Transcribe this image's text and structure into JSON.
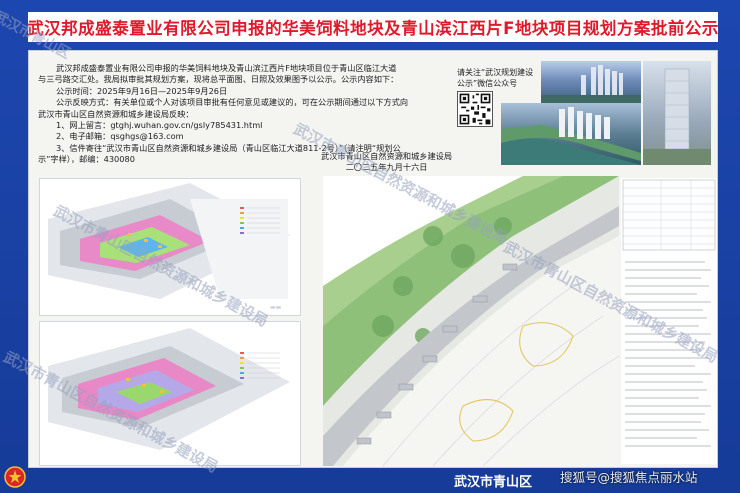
{
  "title": "武汉邦成盛泰置业有限公司申报的华美饲料地块及青山滨江西片F地块项目规划方案批前公示",
  "notice": {
    "lines": [
      "武汉邦成盛泰置业有限公司申报的华美饲料地块及青山滨江西片F地块项目位于青山区临江大道",
      "与三弓路交汇处。我局拟审批其规划方案，现将总平面图、日照及效果图予以公示。公示内容如下：",
      "公示时间：2025年9月16日—2025年9月26日",
      "公示反映方式：有关单位或个人对该项目审批有任何意见或建议的，可在公示期间通过以下方式向",
      "武汉市青山区自然资源和城乡建设局反映：",
      "1、网上留言：gtghj.wuhan.gov.cn/gsly785431.html",
      "2、电子邮箱：qsghgs@163.com",
      "3、信件寄往“武汉市青山区自然资源和城乡建设局（青山区临江大道811-2号）”（请注明“规划公",
      "示”字样），邮编：430080"
    ],
    "signature_org": "武汉市青山区自然资源和城乡建设局",
    "signature_date": "二〇二五年九月十六日"
  },
  "qr": {
    "label": "请关注“武汉规划建设公示”微信公众号"
  },
  "watermarks": {
    "main": "武汉市青山区自然资源和城乡建设局",
    "short": "武汉市青山区"
  },
  "footer": {
    "org": "武汉市青山区",
    "source_watermark": "搜狐号@搜狐焦点丽水站"
  },
  "colors": {
    "frame_blue": "#1d47b0",
    "title_red": "#e0192b",
    "board": "#f4f5f1"
  }
}
